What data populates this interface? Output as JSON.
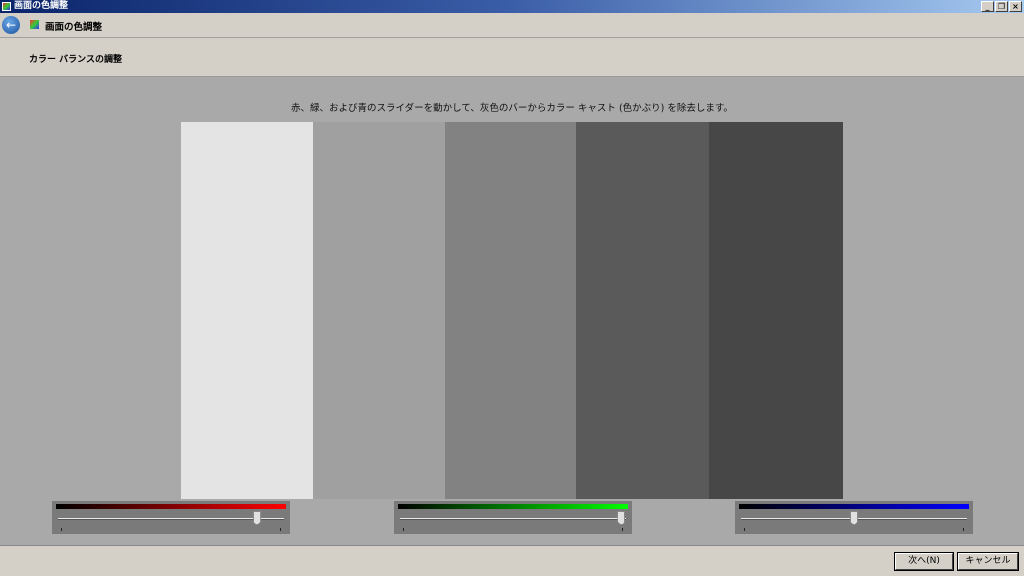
{
  "window": {
    "title": "画面の色調整",
    "minimize": "_",
    "restore": "❐",
    "close": "×"
  },
  "nav": {
    "title": "画面の色調整",
    "back_icon": "←"
  },
  "header": {
    "title": "カラー バランスの調整"
  },
  "main": {
    "instruction": "赤、緑、および青のスライダーを動かして、灰色のバーからカラー キャスト (色かぶり) を除去します。",
    "bars": [
      "#e4e4e4",
      "#a0a0a0",
      "#828282",
      "#5a5a5a",
      "#474747"
    ],
    "sliders": [
      {
        "name": "red",
        "color": "#ff0000",
        "value": 0.88
      },
      {
        "name": "green",
        "color": "#00ff00",
        "value": 0.98
      },
      {
        "name": "blue",
        "color": "#0000ff",
        "value": 0.5
      }
    ]
  },
  "footer": {
    "next": "次へ(N)",
    "cancel": "キャンセル"
  }
}
